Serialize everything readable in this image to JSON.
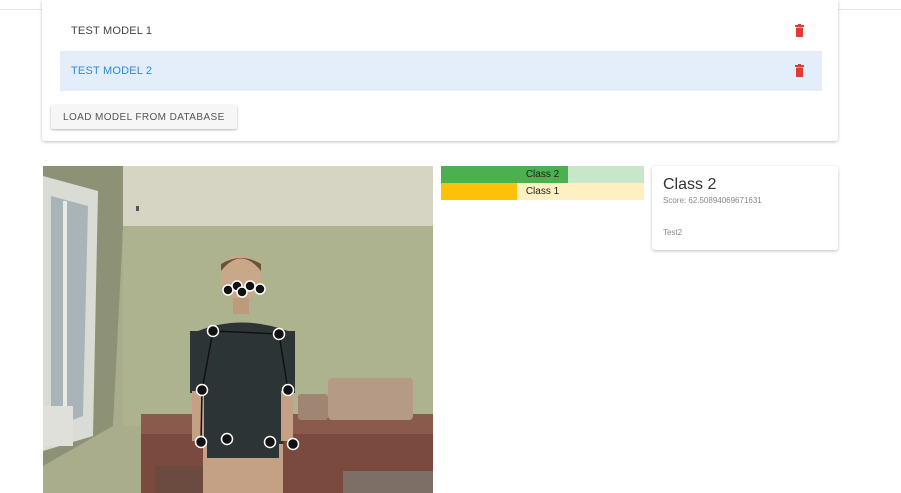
{
  "models": {
    "items": [
      {
        "name": "TEST MODEL 1",
        "selected": false
      },
      {
        "name": "TEST MODEL 2",
        "selected": true
      }
    ],
    "load_button_label": "LOAD MODEL FROM DATABASE",
    "delete_icon": "trash-icon",
    "delete_icon_color": "#e53935"
  },
  "classification": {
    "bars": [
      {
        "label": "Class 2",
        "confidence": 0.625,
        "fill_color": "#4caf50",
        "track_color": "#c8e6c9"
      },
      {
        "label": "Class 1",
        "confidence": 0.375,
        "fill_color": "#ffc107",
        "track_color": "#fff0c2"
      }
    ],
    "result": {
      "class_name": "Class 2",
      "score_text": "Score: 62.50894069671631",
      "model_name": "Test2"
    }
  },
  "colors": {
    "selected_row_bg": "#e3eefa",
    "selected_row_text": "#2f88d8"
  }
}
